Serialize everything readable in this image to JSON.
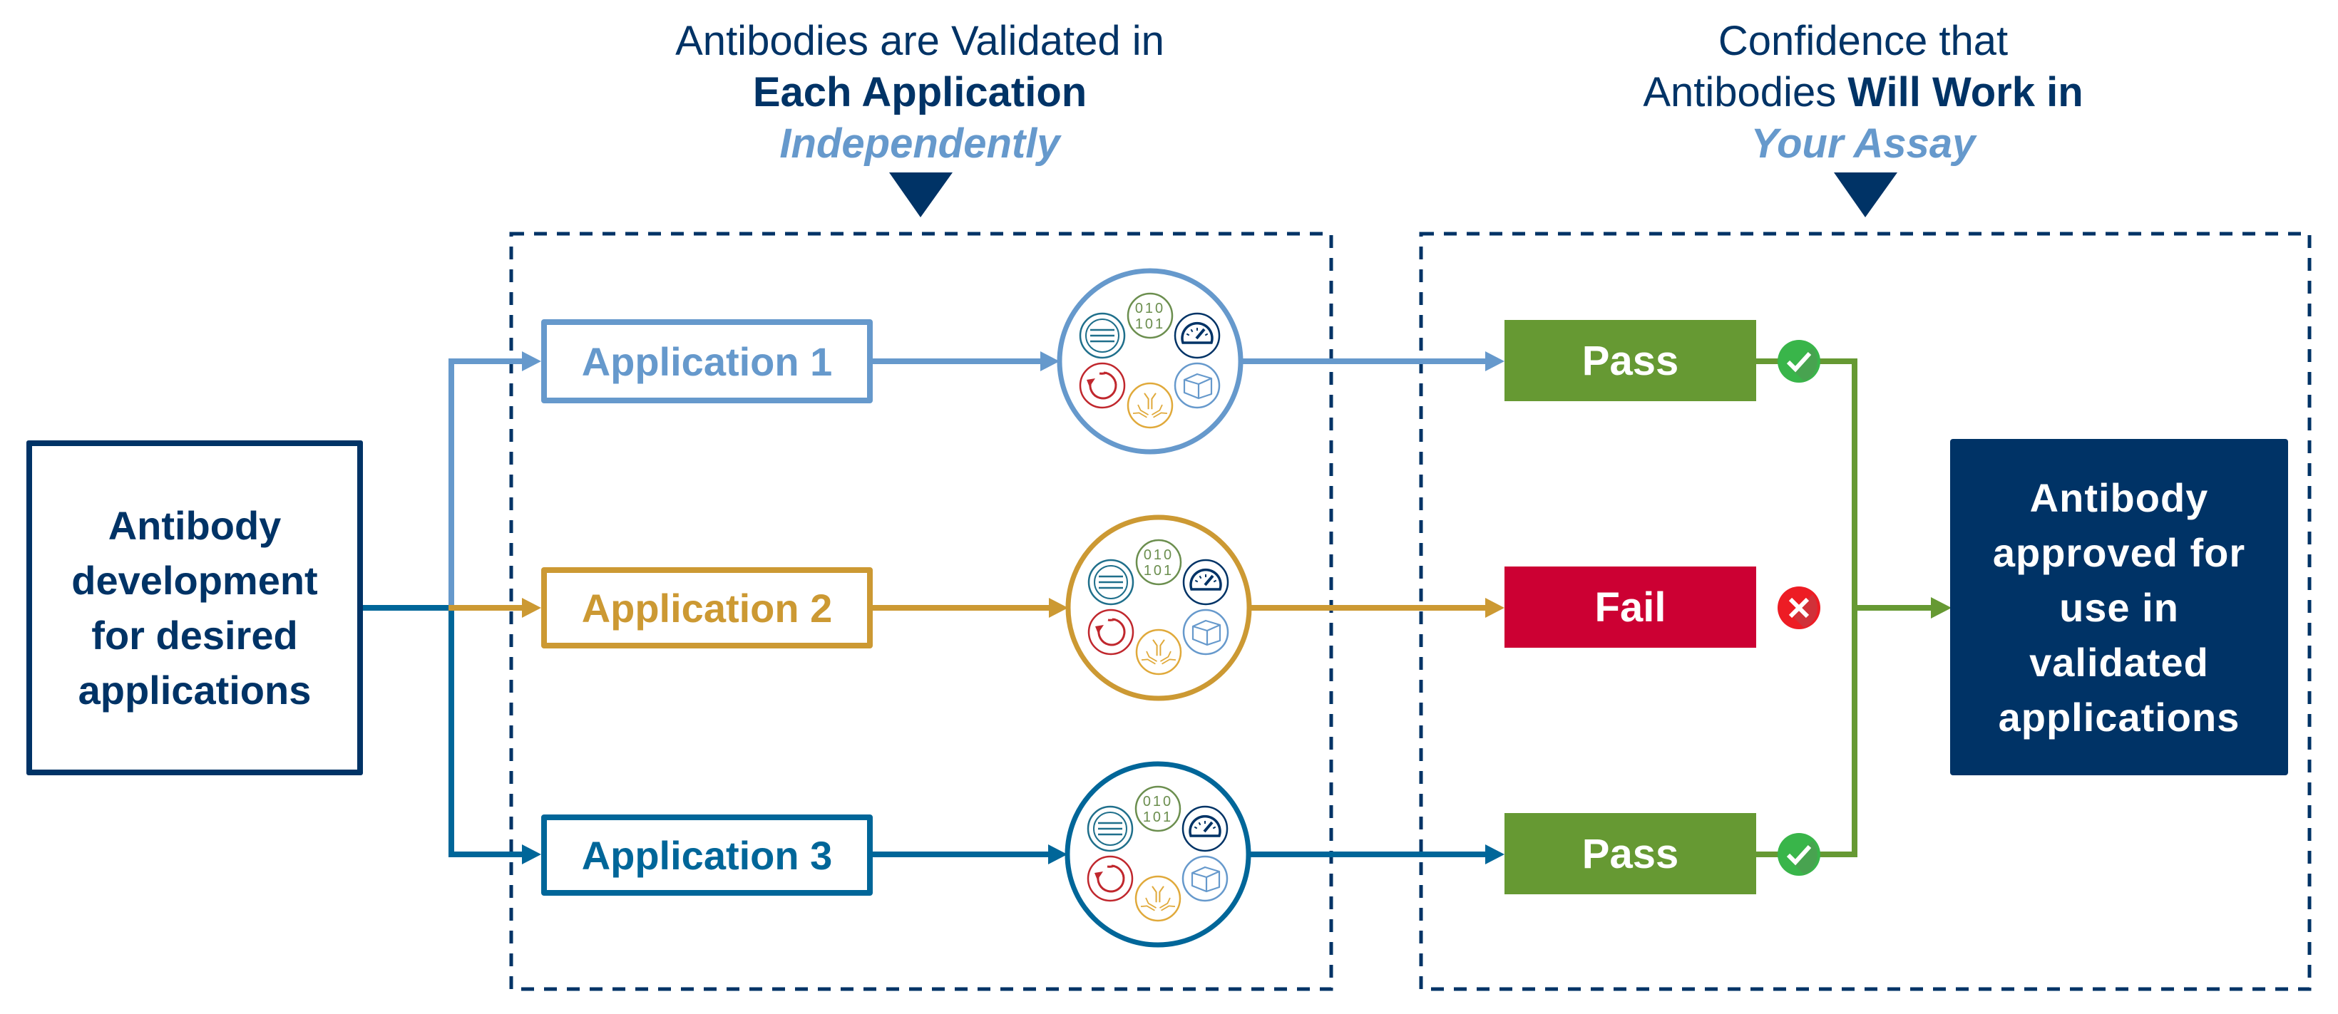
{
  "header_left": {
    "line1": "Antibodies are Validated in",
    "line2": "Each Application",
    "line3": "Independently"
  },
  "header_right": {
    "line1": "Confidence that",
    "line2_regular": "Antibodies ",
    "line2_bold": "Will Work in",
    "line3": "Your Assay"
  },
  "start_box": {
    "lines": [
      "Antibody",
      "development",
      "for desired",
      "applications"
    ]
  },
  "applications": [
    {
      "label": "Application 1",
      "color": "#6699cc",
      "result": "Pass",
      "result_color": "#669933",
      "status_icon": "check-circle-icon"
    },
    {
      "label": "Application 2",
      "color": "#cc9933",
      "result": "Fail",
      "result_color": "#cc0033",
      "status_icon": "x-circle-icon"
    },
    {
      "label": "Application 3",
      "color": "#006699",
      "result": "Pass",
      "result_color": "#669933",
      "status_icon": "check-circle-icon"
    }
  ],
  "validation_icons": [
    {
      "name": "list-lines-icon",
      "color": "#1f6f8b"
    },
    {
      "name": "binary-data-icon",
      "color": "#6b8e4e"
    },
    {
      "name": "gauge-icon",
      "color": "#003366"
    },
    {
      "name": "cycle-arrow-icon",
      "color": "#c0272d"
    },
    {
      "name": "antibody-icon",
      "color": "#e0a93a"
    },
    {
      "name": "cube-icon",
      "color": "#6699cc"
    }
  ],
  "end_box": {
    "lines": [
      "Antibody",
      "approved for",
      "use in",
      "validated",
      "applications"
    ]
  },
  "colors": {
    "navy": "#003366",
    "pass_green": "#669933",
    "fail_red": "#cc0033",
    "check_green": "#39b54a",
    "x_red": "#ed1c24"
  }
}
